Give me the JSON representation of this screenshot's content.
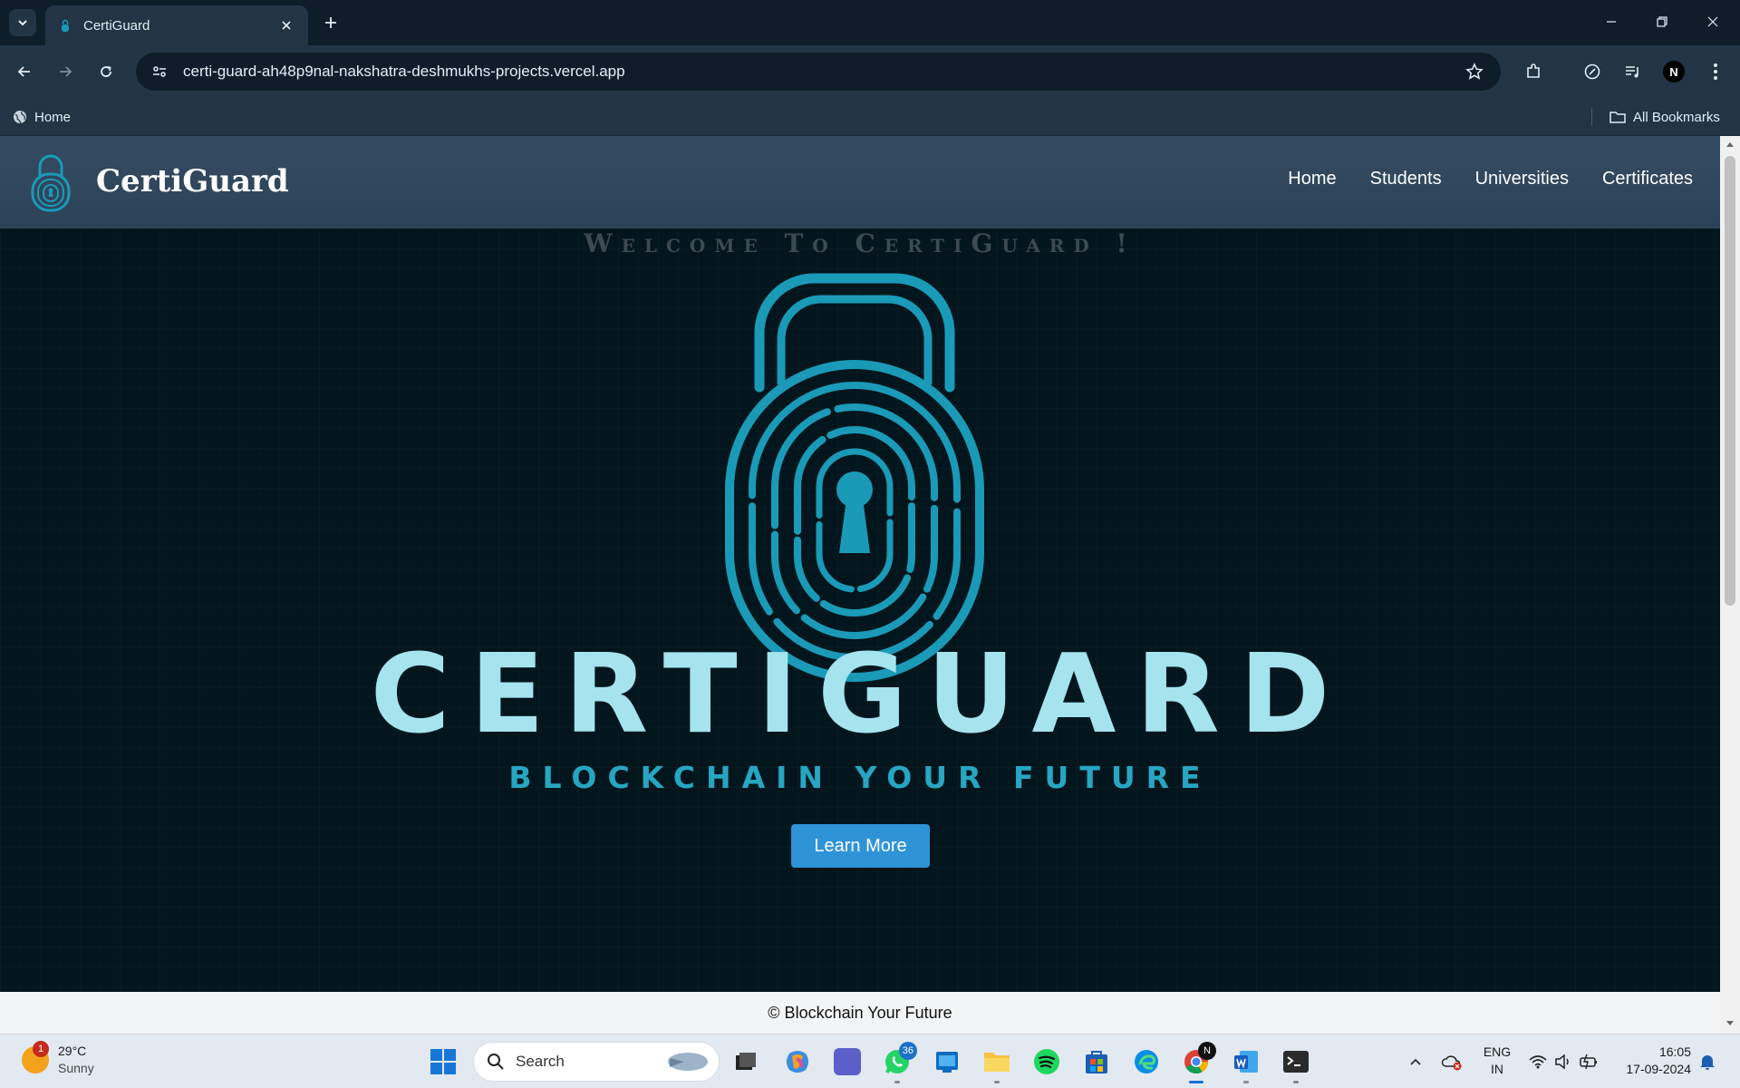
{
  "browser": {
    "tab": {
      "title": "CertiGuard"
    },
    "url": "certi-guard-ah48p9nal-nakshatra-deshmukhs-projects.vercel.app",
    "profile_initial": "N",
    "bookmarks": {
      "home": "Home",
      "all": "All Bookmarks"
    }
  },
  "site": {
    "brand": "CertiGuard",
    "nav": [
      "Home",
      "Students",
      "Universities",
      "Certificates"
    ],
    "hero": {
      "welcome": "Welcome To CertiGuard !",
      "wordmark": "CERTIGUARD",
      "tagline": "BLOCKCHAIN YOUR FUTURE",
      "button": "Learn More"
    },
    "footer": "© Blockchain Your Future",
    "colors": {
      "accent": "#2f93d8",
      "lock": "#1b9ab8",
      "wordmark": "#a5e3ef",
      "tagline": "#27a6c2"
    }
  },
  "taskbar": {
    "weather": {
      "temp": "29°C",
      "condition": "Sunny",
      "alert_count": "1"
    },
    "search_placeholder": "Search",
    "whatsapp_badge": "36",
    "chrome_badge": "N",
    "language": {
      "line1": "ENG",
      "line2": "IN"
    },
    "time": "16:05",
    "date": "17-09-2024"
  }
}
